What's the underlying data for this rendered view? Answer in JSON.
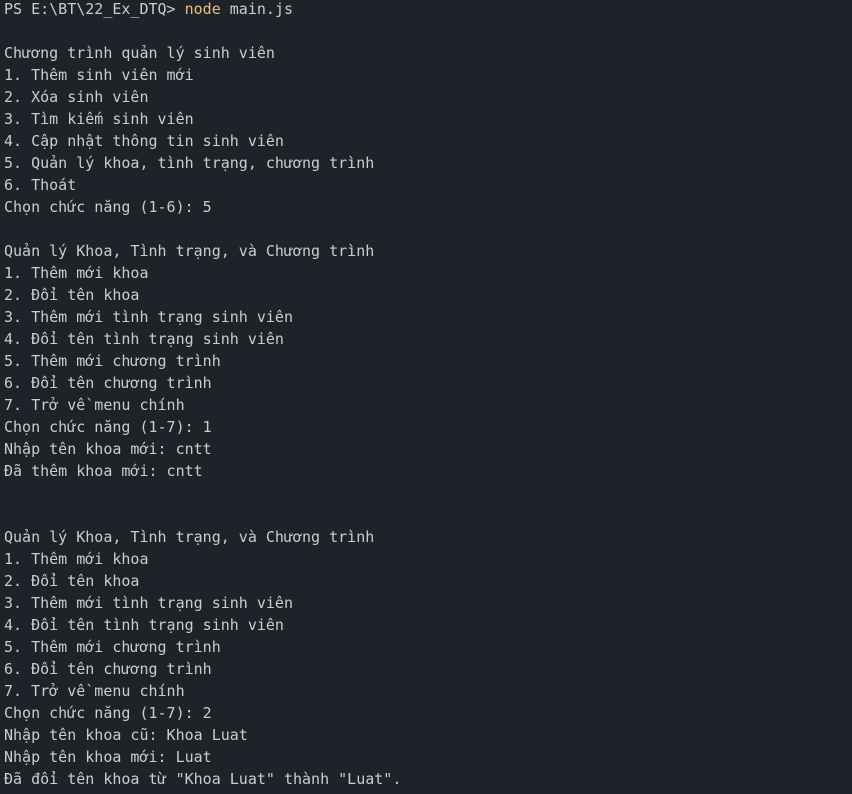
{
  "prompt": {
    "ps_prefix": "PS E:\\BT\\22_Ex_DTQ> ",
    "command": "node",
    "argument": " main.js"
  },
  "lines": [
    "",
    "Chương trình quản lý sinh viên",
    "1. Thêm sinh viên mới",
    "2. Xóa sinh viên",
    "3. Tìm kiếm sinh viên",
    "4. Cập nhật thông tin sinh viên",
    "5. Quản lý khoa, tình trạng, chương trình",
    "6. Thoát",
    "Chọn chức năng (1-6): 5",
    "",
    "Quản lý Khoa, Tình trạng, và Chương trình",
    "1. Thêm mới khoa",
    "2. Đổi tên khoa",
    "3. Thêm mới tình trạng sinh viên",
    "4. Đổi tên tình trạng sinh viên",
    "5. Thêm mới chương trình",
    "6. Đổi tên chương trình",
    "7. Trở về menu chính",
    "Chọn chức năng (1-7): 1",
    "Nhập tên khoa mới: cntt",
    "Đã thêm khoa mới: cntt",
    "",
    "",
    "Quản lý Khoa, Tình trạng, và Chương trình",
    "1. Thêm mới khoa",
    "2. Đổi tên khoa",
    "3. Thêm mới tình trạng sinh viên",
    "4. Đổi tên tình trạng sinh viên",
    "5. Thêm mới chương trình",
    "6. Đổi tên chương trình",
    "7. Trở về menu chính",
    "Chọn chức năng (1-7): 2",
    "Nhập tên khoa cũ: Khoa Luat",
    "Nhập tên khoa mới: Luat",
    "Đã đổi tên khoa từ \"Khoa Luat\" thành \"Luat\"."
  ],
  "colors": {
    "background": "#1f2329",
    "text": "#cccccc",
    "command": "#e5c07b"
  }
}
